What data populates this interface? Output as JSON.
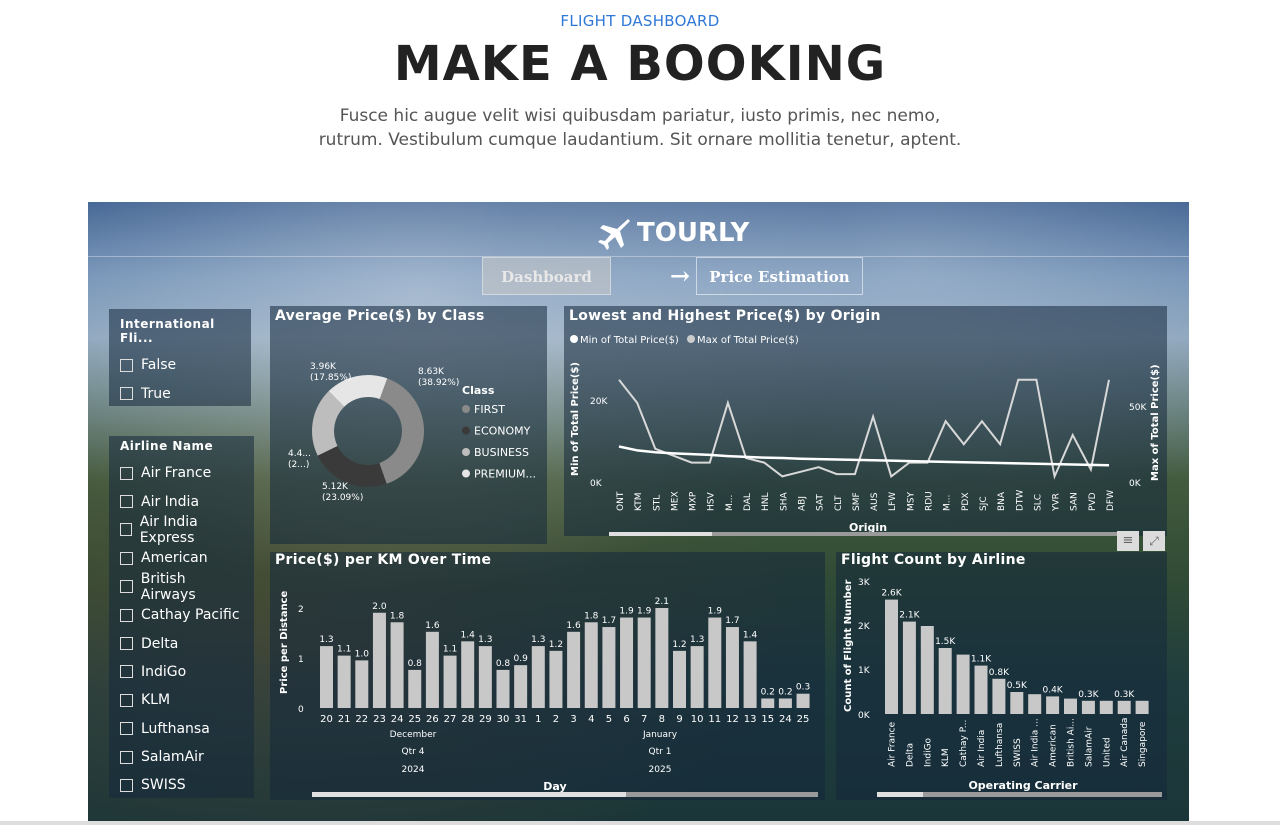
{
  "header": {
    "eyebrow": "FLIGHT DASHBOARD",
    "title": "MAKE A BOOKING",
    "subtitle_line1": "Fusce hic augue velit wisi quibusdam pariatur, iusto primis, nec nemo,",
    "subtitle_line2": "rutrum. Vestibulum cumque laudantium. Sit ornare mollitia tenetur, aptent."
  },
  "dashboard": {
    "logo": "TOURLY",
    "nav": {
      "dashboard": "Dashboard",
      "arrow": "→",
      "price_estimation": "Price Estimation"
    }
  },
  "slicers": {
    "international": {
      "title": "International Fli...",
      "options": [
        "False",
        "True"
      ]
    },
    "airline": {
      "title": "Airline Name",
      "options": [
        "Air France",
        "Air India",
        "Air India Express",
        "American",
        "British Airways",
        "Cathay Pacific",
        "Delta",
        "IndiGo",
        "KLM",
        "Lufthansa",
        "SalamAir",
        "SWISS"
      ]
    }
  },
  "chart_data": [
    {
      "type": "pie",
      "title": "Average Price($) by Class",
      "legend_title": "Class",
      "labels": [
        "FIRST",
        "ECONOMY",
        "BUSINESS",
        "PREMIUM..."
      ],
      "colors": [
        "#8a8a8a",
        "#3a3a3a",
        "#bdbdbd",
        "#e6e6e6"
      ],
      "values": [
        8.63,
        5.12,
        4.4,
        3.96
      ],
      "data_labels": [
        {
          "value": "8.63K",
          "pct": "(38.92%)"
        },
        {
          "value": "5.12K",
          "pct": "(23.09%)"
        },
        {
          "value": "4.4...",
          "pct": "(2...)"
        },
        {
          "value": "3.96K",
          "pct": "(17.85%)"
        }
      ]
    },
    {
      "type": "line",
      "title": "Lowest and Highest Price($) by Origin",
      "xlabel": "Origin",
      "ylabel_left": "Min of Total Price($)",
      "ylabel_right": "Max of Total Price($)",
      "categories": [
        "ONT",
        "KTM",
        "STL",
        "MEX",
        "MXP",
        "HSV",
        "M...",
        "DAL",
        "HNL",
        "SHA",
        "ABJ",
        "SAT",
        "CLT",
        "SMF",
        "AUS",
        "LFW",
        "MSY",
        "RDU",
        "M...",
        "PDX",
        "SJC",
        "BNA",
        "DTW",
        "SLC",
        "YVR",
        "SAN",
        "PVD",
        "DFW"
      ],
      "y_left_ticks": [
        "20K",
        "0K"
      ],
      "y_right_ticks": [
        "50K",
        "0K"
      ],
      "legend": [
        "Min of Total Price($)",
        "Max of Total Price($)"
      ],
      "series": [
        {
          "name": "Min of Total Price($)",
          "values": [
            9,
            8,
            7.5,
            7.2,
            7,
            6.8,
            6.5,
            6.3,
            6.1,
            6,
            5.8,
            5.7,
            5.6,
            5.5,
            5.4,
            5.3,
            5.2,
            5.1,
            5,
            4.9,
            4.8,
            4.7,
            4.6,
            4.5,
            4.4,
            4.3,
            4.2,
            4.1
          ]
        },
        {
          "name": "Max of Total Price($)",
          "values": [
            44,
            34,
            14,
            11,
            8,
            8,
            34,
            10,
            8,
            2,
            4,
            6,
            3,
            3,
            28,
            2,
            8,
            8,
            26,
            16,
            26,
            16,
            44,
            44,
            2,
            20,
            5,
            44
          ]
        }
      ]
    },
    {
      "type": "bar",
      "title": "Price($) per KM Over Time",
      "xlabel": "Day",
      "ylabel": "Price per Distance",
      "y_ticks": [
        "2",
        "1",
        "0"
      ],
      "categories": [
        "20",
        "21",
        "22",
        "23",
        "24",
        "25",
        "26",
        "27",
        "28",
        "29",
        "30",
        "31",
        "1",
        "2",
        "3",
        "4",
        "5",
        "6",
        "7",
        "8",
        "9",
        "10",
        "11",
        "12",
        "13",
        "15",
        "24",
        "25"
      ],
      "values": [
        1.3,
        1.1,
        1.0,
        2.0,
        1.8,
        0.8,
        1.6,
        1.1,
        1.4,
        1.3,
        0.8,
        0.9,
        1.3,
        1.2,
        1.6,
        1.8,
        1.7,
        1.9,
        1.9,
        2.1,
        1.2,
        1.3,
        1.9,
        1.7,
        1.4,
        0.2,
        0.2,
        0.3
      ],
      "month_labels": [
        "December",
        "January"
      ],
      "quarter_labels": [
        "Qtr 4",
        "Qtr 1"
      ],
      "year_labels": [
        "2024",
        "2025"
      ]
    },
    {
      "type": "bar",
      "title": "Flight Count by Airline",
      "xlabel": "Operating Carrier",
      "ylabel": "Count of Flight Number",
      "y_ticks": [
        "3K",
        "2K",
        "1K",
        "0K"
      ],
      "categories": [
        "Air France",
        "Delta",
        "IndiGo",
        "KLM",
        "Cathay P...",
        "Air India",
        "Lufthansa",
        "SWISS",
        "Air India ...",
        "American",
        "British Ai...",
        "SalamAir",
        "United",
        "Air Canada",
        "Singapore"
      ],
      "values": [
        2.6,
        2.1,
        2.0,
        1.5,
        1.35,
        1.1,
        0.8,
        0.5,
        0.45,
        0.4,
        0.35,
        0.3,
        0.3,
        0.3,
        0.3
      ],
      "data_labels": [
        "2.6K",
        "2.1K",
        "",
        "1.5K",
        "",
        "1.1K",
        "0.8K",
        "0.5K",
        "",
        "0.4K",
        "",
        "0.3K",
        "",
        "0.3K",
        ""
      ]
    }
  ]
}
